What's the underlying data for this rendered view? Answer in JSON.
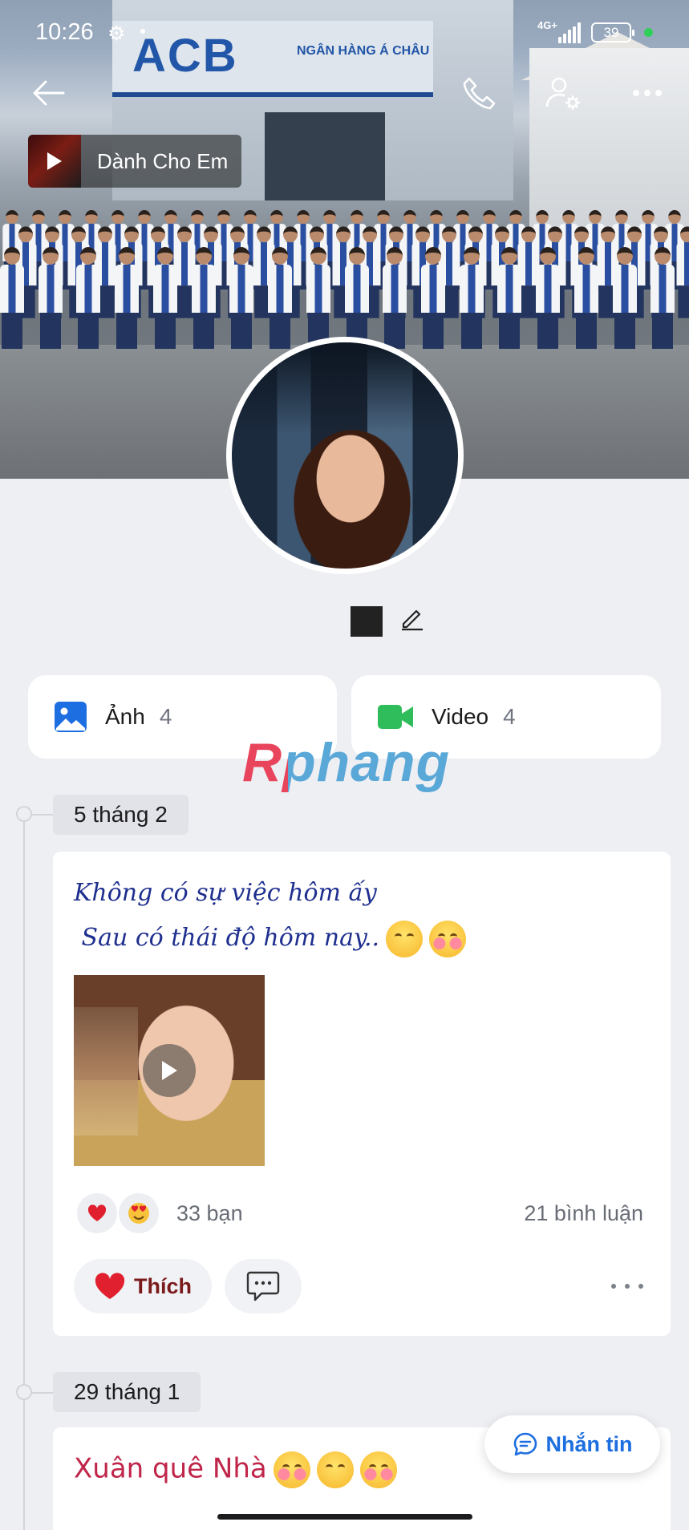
{
  "status_bar": {
    "time": "10:26",
    "network": "4G+",
    "battery": "39"
  },
  "cover": {
    "sign_text": "ACB",
    "bank_name": "NGÂN HÀNG Á CHÂU"
  },
  "music": {
    "title": "Dành Cho Em"
  },
  "media_tabs": [
    {
      "label": "Ảnh",
      "count": "4"
    },
    {
      "label": "Video",
      "count": "4"
    }
  ],
  "watermark": "Rphang",
  "posts": [
    {
      "date": "5 tháng 2",
      "text_line1": "Không có sự việc hôm ấy",
      "text_line2": " Sau có thái độ hôm nay..",
      "reactions_count": "33 bạn",
      "comments_count": "21 bình luận",
      "like_label": "Thích"
    },
    {
      "date": "29 tháng 1",
      "text": "Xuân quê Nhà"
    }
  ],
  "message_button": {
    "label": "Nhắn tin"
  },
  "colors": {
    "accent_blue": "#1d6ee0",
    "video_green": "#2fbd5c",
    "like_red": "#e0202e"
  }
}
